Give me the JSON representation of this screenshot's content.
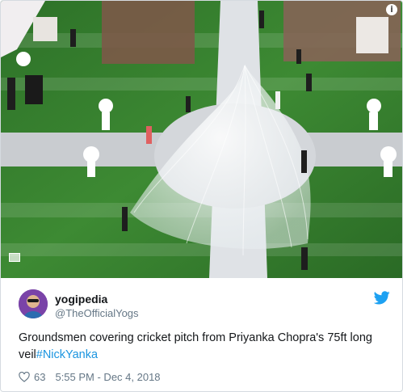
{
  "tweet": {
    "display_name": "yogipedia",
    "handle": "@TheOfficialYogs",
    "text": "Groundsmen covering cricket pitch from Priyanka Chopra's 75ft long veil",
    "hashtag": "#NickYanka",
    "likes": "63",
    "timestamp": "5:55 PM - Dec 4, 2018"
  },
  "icons": {
    "info": "info-icon",
    "brand": "twitter-bird-icon",
    "like": "heart-icon"
  },
  "colors": {
    "link": "#1b95e0",
    "brand": "#1da1f2",
    "text": "#14171a",
    "secondary": "#657786",
    "lawn": "#2f7a2a"
  }
}
